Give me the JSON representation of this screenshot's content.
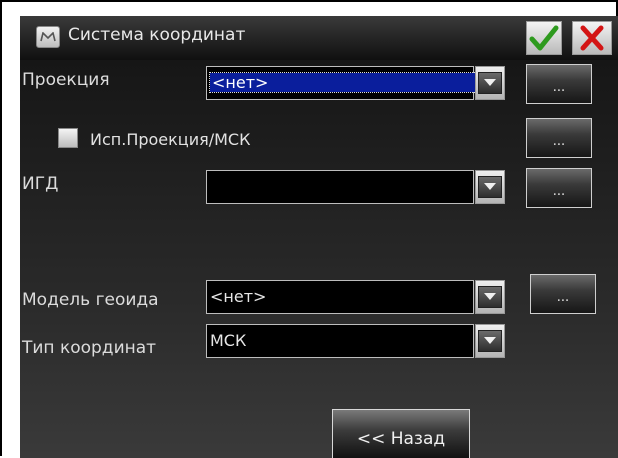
{
  "window": {
    "title": "Система координат",
    "ok_icon": "checkmark-icon",
    "cancel_icon": "close-icon",
    "ok_color": "#2e9a1e",
    "cancel_color": "#d31414"
  },
  "form": {
    "projection": {
      "label": "Проекция",
      "value": "<нет>",
      "button": "..."
    },
    "use_projection": {
      "label": "Исп.Проекция/МСК",
      "checked": false,
      "button": "..."
    },
    "datum": {
      "label": "ИГД",
      "value": "",
      "button": "..."
    },
    "geoid_model": {
      "label": "Модель геоида",
      "value": "<нет>",
      "button": "..."
    },
    "coord_type": {
      "label": "Тип координат",
      "value": "МСК"
    }
  },
  "footer": {
    "back_label": "<< Назад"
  }
}
